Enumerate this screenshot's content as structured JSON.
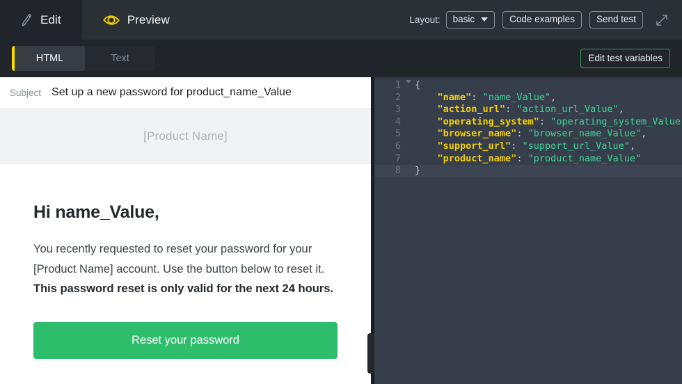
{
  "topbar": {
    "tabs": [
      {
        "label": "Edit",
        "icon": "pencil-icon",
        "active": false
      },
      {
        "label": "Preview",
        "icon": "eye-icon",
        "active": true
      }
    ],
    "layout_label": "Layout:",
    "layout_value": "basic",
    "code_examples_label": "Code examples",
    "send_test_label": "Send test",
    "expand_icon": "expand-arrows-icon"
  },
  "subbar": {
    "segments": [
      {
        "label": "HTML",
        "active": true
      },
      {
        "label": "Text",
        "active": false
      }
    ],
    "accent_color": "#ffdd00",
    "edit_test_variables_label": "Edit test variables",
    "edit_test_variables_border": "#2f9e5e"
  },
  "preview": {
    "subject_key": "Subject",
    "subject_value": "Set up a new password for product_name_Value",
    "band_product_name": "[Product Name]",
    "greeting": "Hi name_Value,",
    "body_plain_1": "You recently requested to reset your password for your [Product Name] account. Use the button below to reset it. ",
    "body_bold": "This password reset is only valid for the next 24 hours.",
    "cta_label": "Reset your password",
    "cta_color": "#2ebd6b"
  },
  "editor": {
    "language": "json",
    "active_line": 8,
    "lines": [
      {
        "n": "1",
        "fold": true,
        "tokens": [
          {
            "t": "punct",
            "v": "{"
          }
        ]
      },
      {
        "n": "2",
        "fold": false,
        "tokens": [
          {
            "t": "indent",
            "v": "    "
          },
          {
            "t": "key",
            "v": "\"name\""
          },
          {
            "t": "colon",
            "v": ":"
          },
          {
            "t": "sp",
            "v": " "
          },
          {
            "t": "str",
            "v": "\"name_Value\""
          },
          {
            "t": "comma",
            "v": ","
          }
        ]
      },
      {
        "n": "3",
        "fold": false,
        "tokens": [
          {
            "t": "indent",
            "v": "    "
          },
          {
            "t": "key",
            "v": "\"action_url\""
          },
          {
            "t": "colon",
            "v": ":"
          },
          {
            "t": "sp",
            "v": " "
          },
          {
            "t": "str",
            "v": "\"action_url_Value\""
          },
          {
            "t": "comma",
            "v": ","
          }
        ]
      },
      {
        "n": "4",
        "fold": false,
        "tokens": [
          {
            "t": "indent",
            "v": "    "
          },
          {
            "t": "key",
            "v": "\"operating_system\""
          },
          {
            "t": "colon",
            "v": ":"
          },
          {
            "t": "sp",
            "v": " "
          },
          {
            "t": "str",
            "v": "\"operating_system_Value\""
          },
          {
            "t": "comma",
            "v": ","
          }
        ]
      },
      {
        "n": "5",
        "fold": false,
        "tokens": [
          {
            "t": "indent",
            "v": "    "
          },
          {
            "t": "key",
            "v": "\"browser_name\""
          },
          {
            "t": "colon",
            "v": ":"
          },
          {
            "t": "sp",
            "v": " "
          },
          {
            "t": "str",
            "v": "\"browser_name_Value\""
          },
          {
            "t": "comma",
            "v": ","
          }
        ]
      },
      {
        "n": "6",
        "fold": false,
        "tokens": [
          {
            "t": "indent",
            "v": "    "
          },
          {
            "t": "key",
            "v": "\"support_url\""
          },
          {
            "t": "colon",
            "v": ":"
          },
          {
            "t": "sp",
            "v": " "
          },
          {
            "t": "str",
            "v": "\"support_url_Value\""
          },
          {
            "t": "comma",
            "v": ","
          }
        ]
      },
      {
        "n": "7",
        "fold": false,
        "tokens": [
          {
            "t": "indent",
            "v": "    "
          },
          {
            "t": "key",
            "v": "\"product_name\""
          },
          {
            "t": "colon",
            "v": ":"
          },
          {
            "t": "sp",
            "v": " "
          },
          {
            "t": "str",
            "v": "\"product_name_Value\""
          }
        ]
      },
      {
        "n": "8",
        "fold": false,
        "tokens": [
          {
            "t": "punct",
            "v": "}"
          }
        ]
      }
    ]
  }
}
